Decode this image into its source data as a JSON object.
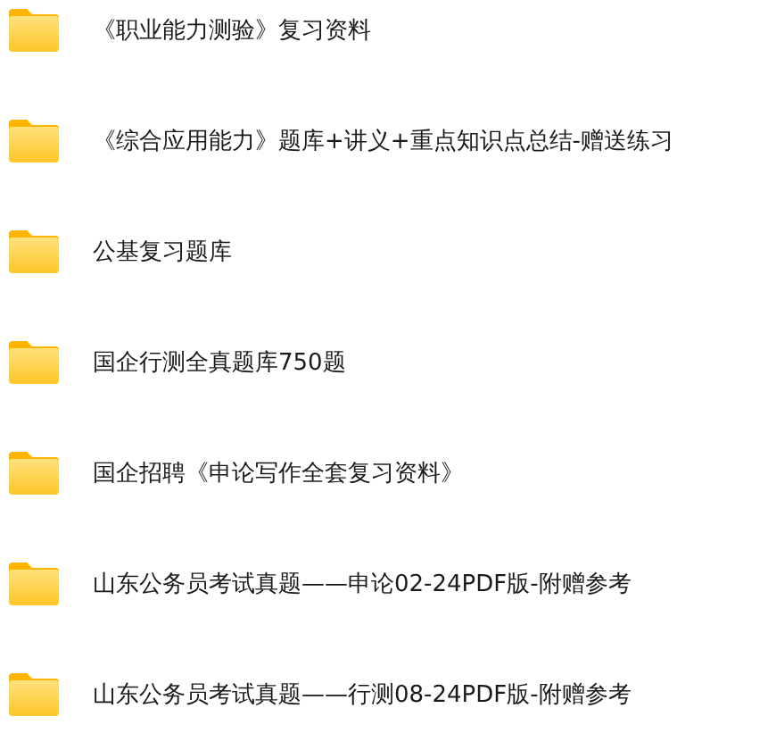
{
  "folders": [
    {
      "name": "《职业能力测验》复习资料"
    },
    {
      "name": "《综合应用能力》题库+讲义+重点知识点总结-赠送练习"
    },
    {
      "name": "公基复习题库"
    },
    {
      "name": "国企行测全真题库750题"
    },
    {
      "name": "国企招聘《申论写作全套复习资料》"
    },
    {
      "name": "山东公务员考试真题——申论02-24PDF版-附赠参考"
    },
    {
      "name": "山东公务员考试真题——行测08-24PDF版-附赠参考"
    }
  ]
}
